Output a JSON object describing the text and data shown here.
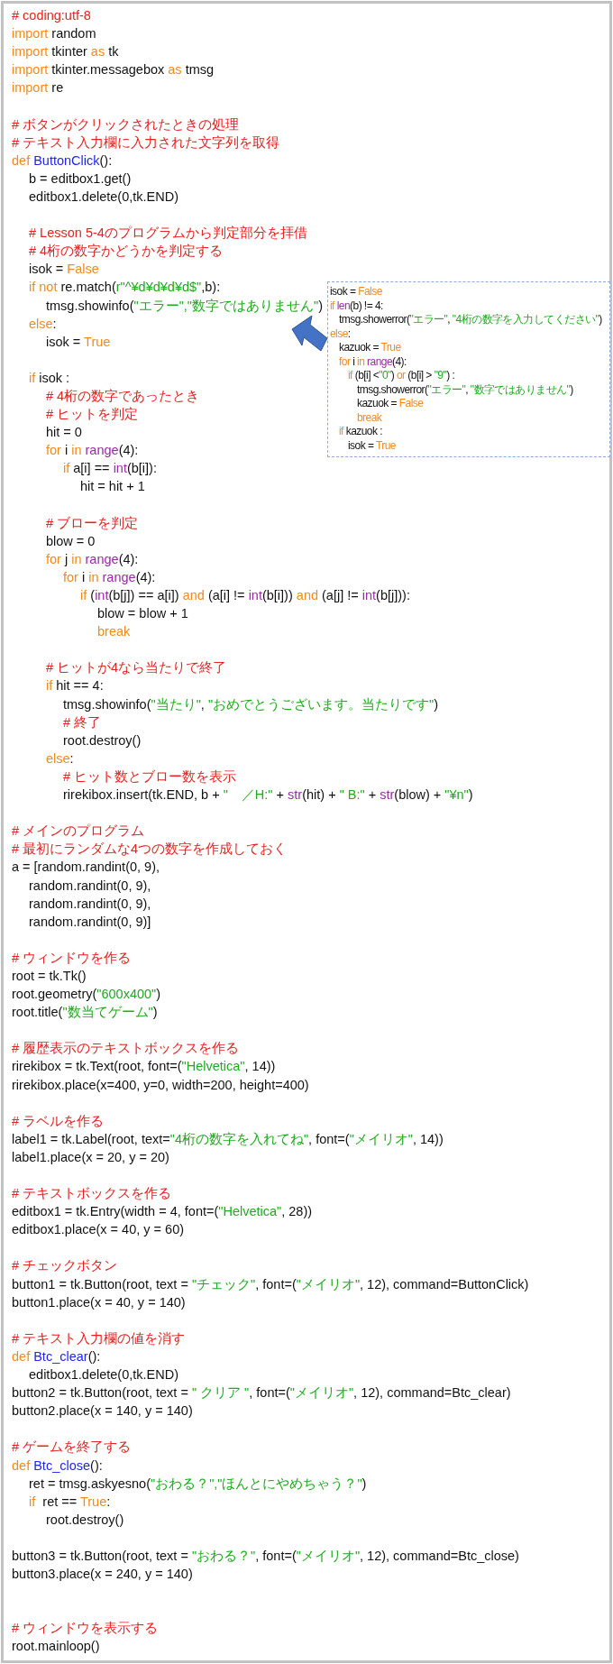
{
  "code_listing": {
    "lines": [
      {
        "kind": "code",
        "tokens": [
          {
            "kind": "comment",
            "text": "# coding:utf-8"
          }
        ]
      },
      {
        "kind": "code",
        "tokens": [
          {
            "kind": "keyword",
            "text": "import"
          },
          {
            "kind": "plain",
            "text": " random"
          }
        ]
      },
      {
        "kind": "code",
        "tokens": [
          {
            "kind": "keyword",
            "text": "import"
          },
          {
            "kind": "plain",
            "text": " tkinter "
          },
          {
            "kind": "keyword",
            "text": "as"
          },
          {
            "kind": "plain",
            "text": " tk"
          }
        ]
      },
      {
        "kind": "code",
        "tokens": [
          {
            "kind": "keyword",
            "text": "import"
          },
          {
            "kind": "plain",
            "text": " tkinter.messagebox "
          },
          {
            "kind": "keyword",
            "text": "as"
          },
          {
            "kind": "plain",
            "text": " tmsg"
          }
        ]
      },
      {
        "kind": "code",
        "tokens": [
          {
            "kind": "keyword",
            "text": "import"
          },
          {
            "kind": "plain",
            "text": " re"
          }
        ]
      },
      {
        "kind": "blank"
      },
      {
        "kind": "code",
        "tokens": [
          {
            "kind": "comment",
            "text": "# ボタンがクリックされたときの処理"
          }
        ]
      },
      {
        "kind": "code",
        "tokens": [
          {
            "kind": "comment",
            "text": "# テキスト入力欄に入力された文字列を取得"
          }
        ]
      },
      {
        "kind": "code",
        "tokens": [
          {
            "kind": "keyword",
            "text": "def "
          },
          {
            "kind": "function",
            "text": "ButtonClick"
          },
          {
            "kind": "plain",
            "text": "():"
          }
        ],
        "children": [
          {
            "kind": "code",
            "tokens": [
              {
                "kind": "plain",
                "text": "b = editbox1.get()"
              }
            ]
          },
          {
            "kind": "code",
            "tokens": [
              {
                "kind": "plain",
                "text": "editbox1.delete(0,tk.END)"
              }
            ]
          },
          {
            "kind": "blank"
          },
          {
            "kind": "code",
            "tokens": [
              {
                "kind": "comment",
                "text": "# Lesson 5-4のプログラムから判定部分を拝借"
              }
            ]
          },
          {
            "kind": "code",
            "tokens": [
              {
                "kind": "comment",
                "text": "# 4桁の数字かどうかを判定する"
              }
            ]
          },
          {
            "kind": "code",
            "tokens": [
              {
                "kind": "plain",
                "text": "isok = "
              },
              {
                "kind": "keyword",
                "text": "False"
              }
            ]
          },
          {
            "kind": "code",
            "tokens": [
              {
                "kind": "keyword",
                "text": "if not "
              },
              {
                "kind": "plain",
                "text": "re.match("
              },
              {
                "kind": "string",
                "text": "r\"^¥d¥d¥d¥d$\""
              },
              {
                "kind": "plain",
                "text": ",b):"
              }
            ],
            "children": [
              {
                "kind": "code",
                "tokens": [
                  {
                    "kind": "plain",
                    "text": "tmsg.showinfo("
                  },
                  {
                    "kind": "string",
                    "text": "\"エラー\",\"数字ではありません\""
                  },
                  {
                    "kind": "plain",
                    "text": ")"
                  }
                ]
              }
            ]
          },
          {
            "kind": "code",
            "tokens": [
              {
                "kind": "keyword",
                "text": "else"
              },
              {
                "kind": "plain",
                "text": ":"
              }
            ],
            "children": [
              {
                "kind": "code",
                "tokens": [
                  {
                    "kind": "plain",
                    "text": "isok = "
                  },
                  {
                    "kind": "keyword",
                    "text": "True"
                  }
                ]
              }
            ]
          },
          {
            "kind": "blank"
          },
          {
            "kind": "code",
            "tokens": [
              {
                "kind": "keyword",
                "text": "if "
              },
              {
                "kind": "plain",
                "text": "isok :"
              }
            ],
            "children": [
              {
                "kind": "code",
                "tokens": [
                  {
                    "kind": "comment",
                    "text": "# 4桁の数字であったとき"
                  }
                ]
              },
              {
                "kind": "code",
                "tokens": [
                  {
                    "kind": "comment",
                    "text": "# ヒットを判定"
                  }
                ]
              },
              {
                "kind": "code",
                "tokens": [
                  {
                    "kind": "plain",
                    "text": "hit = 0"
                  }
                ]
              },
              {
                "kind": "code",
                "tokens": [
                  {
                    "kind": "keyword",
                    "text": "for "
                  },
                  {
                    "kind": "plain",
                    "text": "i "
                  },
                  {
                    "kind": "keyword",
                    "text": "in "
                  },
                  {
                    "kind": "builtin",
                    "text": "range"
                  },
                  {
                    "kind": "plain",
                    "text": "(4):"
                  }
                ],
                "children": [
                  {
                    "kind": "code",
                    "tokens": [
                      {
                        "kind": "keyword",
                        "text": "if "
                      },
                      {
                        "kind": "plain",
                        "text": "a[i] == "
                      },
                      {
                        "kind": "builtin",
                        "text": "int"
                      },
                      {
                        "kind": "plain",
                        "text": "(b[i]):"
                      }
                    ],
                    "children": [
                      {
                        "kind": "code",
                        "tokens": [
                          {
                            "kind": "plain",
                            "text": "hit = hit + 1"
                          }
                        ]
                      }
                    ]
                  }
                ]
              },
              {
                "kind": "blank"
              },
              {
                "kind": "code",
                "tokens": [
                  {
                    "kind": "comment",
                    "text": "# ブローを判定"
                  }
                ]
              },
              {
                "kind": "code",
                "tokens": [
                  {
                    "kind": "plain",
                    "text": "blow = 0"
                  }
                ]
              },
              {
                "kind": "code",
                "tokens": [
                  {
                    "kind": "keyword",
                    "text": "for "
                  },
                  {
                    "kind": "plain",
                    "text": "j "
                  },
                  {
                    "kind": "keyword",
                    "text": "in "
                  },
                  {
                    "kind": "builtin",
                    "text": "range"
                  },
                  {
                    "kind": "plain",
                    "text": "(4):"
                  }
                ],
                "children": [
                  {
                    "kind": "code",
                    "tokens": [
                      {
                        "kind": "keyword",
                        "text": "for "
                      },
                      {
                        "kind": "plain",
                        "text": "i "
                      },
                      {
                        "kind": "keyword",
                        "text": "in "
                      },
                      {
                        "kind": "builtin",
                        "text": "range"
                      },
                      {
                        "kind": "plain",
                        "text": "(4):"
                      }
                    ],
                    "children": [
                      {
                        "kind": "code",
                        "tokens": [
                          {
                            "kind": "keyword",
                            "text": "if "
                          },
                          {
                            "kind": "plain",
                            "text": "("
                          },
                          {
                            "kind": "builtin",
                            "text": "int"
                          },
                          {
                            "kind": "plain",
                            "text": "(b[j]) == a[i]) "
                          },
                          {
                            "kind": "keyword",
                            "text": "and"
                          },
                          {
                            "kind": "plain",
                            "text": " (a[i] != "
                          },
                          {
                            "kind": "builtin",
                            "text": "int"
                          },
                          {
                            "kind": "plain",
                            "text": "(b[i])) "
                          },
                          {
                            "kind": "keyword",
                            "text": "and"
                          },
                          {
                            "kind": "plain",
                            "text": " (a[j] != "
                          },
                          {
                            "kind": "builtin",
                            "text": "int"
                          },
                          {
                            "kind": "plain",
                            "text": "(b[j])):"
                          }
                        ],
                        "children": [
                          {
                            "kind": "code",
                            "tokens": [
                              {
                                "kind": "plain",
                                "text": "blow = blow + 1"
                              }
                            ]
                          },
                          {
                            "kind": "code",
                            "tokens": [
                              {
                                "kind": "keyword",
                                "text": "break"
                              }
                            ]
                          }
                        ]
                      }
                    ]
                  }
                ]
              },
              {
                "kind": "blank"
              },
              {
                "kind": "code",
                "tokens": [
                  {
                    "kind": "comment",
                    "text": "# ヒットが4なら当たりで終了"
                  }
                ]
              },
              {
                "kind": "code",
                "tokens": [
                  {
                    "kind": "keyword",
                    "text": "if "
                  },
                  {
                    "kind": "plain",
                    "text": "hit == 4:"
                  }
                ],
                "children": [
                  {
                    "kind": "code",
                    "tokens": [
                      {
                        "kind": "plain",
                        "text": "tmsg.showinfo("
                      },
                      {
                        "kind": "string",
                        "text": "\"当たり\""
                      },
                      {
                        "kind": "plain",
                        "text": ", "
                      },
                      {
                        "kind": "string",
                        "text": "\"おめでとうございます。当たりです\""
                      },
                      {
                        "kind": "plain",
                        "text": ")"
                      }
                    ]
                  },
                  {
                    "kind": "code",
                    "tokens": [
                      {
                        "kind": "comment",
                        "text": "# 終了"
                      }
                    ]
                  },
                  {
                    "kind": "code",
                    "tokens": [
                      {
                        "kind": "plain",
                        "text": "root.destroy()"
                      }
                    ]
                  }
                ]
              },
              {
                "kind": "code",
                "tokens": [
                  {
                    "kind": "keyword",
                    "text": "else"
                  },
                  {
                    "kind": "plain",
                    "text": ":"
                  }
                ],
                "children": [
                  {
                    "kind": "code",
                    "tokens": [
                      {
                        "kind": "comment",
                        "text": "# ヒット数とブロー数を表示"
                      }
                    ]
                  },
                  {
                    "kind": "code",
                    "tokens": [
                      {
                        "kind": "plain",
                        "text": "rirekibox.insert(tk.END, b + "
                      },
                      {
                        "kind": "string",
                        "text": "\"　／H:\""
                      },
                      {
                        "kind": "plain",
                        "text": " + "
                      },
                      {
                        "kind": "builtin",
                        "text": "str"
                      },
                      {
                        "kind": "plain",
                        "text": "(hit) + "
                      },
                      {
                        "kind": "string",
                        "text": "\" B:\""
                      },
                      {
                        "kind": "plain",
                        "text": " + "
                      },
                      {
                        "kind": "builtin",
                        "text": "str"
                      },
                      {
                        "kind": "plain",
                        "text": "(blow) + "
                      },
                      {
                        "kind": "string",
                        "text": "\"¥n\""
                      },
                      {
                        "kind": "plain",
                        "text": ")"
                      }
                    ]
                  }
                ]
              }
            ]
          }
        ]
      },
      {
        "kind": "blank"
      },
      {
        "kind": "code",
        "tokens": [
          {
            "kind": "comment",
            "text": "# メインのプログラム"
          }
        ]
      },
      {
        "kind": "code",
        "tokens": [
          {
            "kind": "comment",
            "text": "# 最初にランダムな4つの数字を作成しておく"
          }
        ]
      },
      {
        "kind": "code",
        "tokens": [
          {
            "kind": "plain",
            "text": "a = [random.randint(0, 9),"
          }
        ],
        "children": [
          {
            "kind": "code",
            "tokens": [
              {
                "kind": "plain",
                "text": "random.randint(0, 9),"
              }
            ]
          },
          {
            "kind": "code",
            "tokens": [
              {
                "kind": "plain",
                "text": "random.randint(0, 9),"
              }
            ]
          },
          {
            "kind": "code",
            "tokens": [
              {
                "kind": "plain",
                "text": "random.randint(0, 9)]"
              }
            ]
          }
        ]
      },
      {
        "kind": "blank"
      },
      {
        "kind": "code",
        "tokens": [
          {
            "kind": "comment",
            "text": "# ウィンドウを作る"
          }
        ]
      },
      {
        "kind": "code",
        "tokens": [
          {
            "kind": "plain",
            "text": "root = tk.Tk()"
          }
        ]
      },
      {
        "kind": "code",
        "tokens": [
          {
            "kind": "plain",
            "text": "root.geometry("
          },
          {
            "kind": "string",
            "text": "\"600x400\""
          },
          {
            "kind": "plain",
            "text": ")"
          }
        ]
      },
      {
        "kind": "code",
        "tokens": [
          {
            "kind": "plain",
            "text": "root.title("
          },
          {
            "kind": "string",
            "text": "\"数当てゲーム\""
          },
          {
            "kind": "plain",
            "text": ")"
          }
        ]
      },
      {
        "kind": "blank"
      },
      {
        "kind": "code",
        "tokens": [
          {
            "kind": "comment",
            "text": "# 履歴表示のテキストボックスを作る"
          }
        ]
      },
      {
        "kind": "code",
        "tokens": [
          {
            "kind": "plain",
            "text": "rirekibox = tk.Text(root, font=("
          },
          {
            "kind": "string",
            "text": "\"Helvetica\""
          },
          {
            "kind": "plain",
            "text": ", 14))"
          }
        ]
      },
      {
        "kind": "code",
        "tokens": [
          {
            "kind": "plain",
            "text": "rirekibox.place(x=400, y=0, width=200, height=400)"
          }
        ]
      },
      {
        "kind": "blank"
      },
      {
        "kind": "code",
        "tokens": [
          {
            "kind": "comment",
            "text": "# ラベルを作る"
          }
        ]
      },
      {
        "kind": "code",
        "tokens": [
          {
            "kind": "plain",
            "text": "label1 = tk.Label(root, text="
          },
          {
            "kind": "string",
            "text": "\"4桁の数字を入れてね\""
          },
          {
            "kind": "plain",
            "text": ", font=("
          },
          {
            "kind": "string",
            "text": "\"メイリオ\""
          },
          {
            "kind": "plain",
            "text": ", 14))"
          }
        ]
      },
      {
        "kind": "code",
        "tokens": [
          {
            "kind": "plain",
            "text": "label1.place(x = 20, y = 20)"
          }
        ]
      },
      {
        "kind": "blank"
      },
      {
        "kind": "code",
        "tokens": [
          {
            "kind": "comment",
            "text": "# テキストボックスを作る"
          }
        ]
      },
      {
        "kind": "code",
        "tokens": [
          {
            "kind": "plain",
            "text": "editbox1 = tk.Entry(width = 4, font=("
          },
          {
            "kind": "string",
            "text": "\"Helvetica\""
          },
          {
            "kind": "plain",
            "text": ", 28))"
          }
        ]
      },
      {
        "kind": "code",
        "tokens": [
          {
            "kind": "plain",
            "text": "editbox1.place(x = 40, y = 60)"
          }
        ]
      },
      {
        "kind": "blank"
      },
      {
        "kind": "code",
        "tokens": [
          {
            "kind": "comment",
            "text": "# チェックボタン"
          }
        ]
      },
      {
        "kind": "code",
        "tokens": [
          {
            "kind": "plain",
            "text": "button1 = tk.Button(root, text = "
          },
          {
            "kind": "string",
            "text": "\"チェック\""
          },
          {
            "kind": "plain",
            "text": ", font=("
          },
          {
            "kind": "string",
            "text": "\"メイリオ\""
          },
          {
            "kind": "plain",
            "text": ", 12), command=ButtonClick)"
          }
        ]
      },
      {
        "kind": "code",
        "tokens": [
          {
            "kind": "plain",
            "text": "button1.place(x = 40, y = 140)"
          }
        ]
      },
      {
        "kind": "blank"
      },
      {
        "kind": "code",
        "tokens": [
          {
            "kind": "comment",
            "text": "# テキスト入力欄の値を消す"
          }
        ]
      },
      {
        "kind": "code",
        "tokens": [
          {
            "kind": "keyword",
            "text": "def "
          },
          {
            "kind": "function",
            "text": "Btc_clear"
          },
          {
            "kind": "plain",
            "text": "():"
          }
        ],
        "children": [
          {
            "kind": "code",
            "tokens": [
              {
                "kind": "plain",
                "text": "editbox1.delete(0,tk.END)"
              }
            ]
          }
        ]
      },
      {
        "kind": "code",
        "tokens": [
          {
            "kind": "plain",
            "text": "button2 = tk.Button(root, text = "
          },
          {
            "kind": "string",
            "text": "\" クリア \""
          },
          {
            "kind": "plain",
            "text": ", font=("
          },
          {
            "kind": "string",
            "text": "\"メイリオ\""
          },
          {
            "kind": "plain",
            "text": ", 12), command=Btc_clear)"
          }
        ]
      },
      {
        "kind": "code",
        "tokens": [
          {
            "kind": "plain",
            "text": "button2.place(x = 140, y = 140)"
          }
        ]
      },
      {
        "kind": "blank"
      },
      {
        "kind": "code",
        "tokens": [
          {
            "kind": "comment",
            "text": "# ゲームを終了する"
          }
        ]
      },
      {
        "kind": "code",
        "tokens": [
          {
            "kind": "keyword",
            "text": "def "
          },
          {
            "kind": "function",
            "text": "Btc_close"
          },
          {
            "kind": "plain",
            "text": "():"
          }
        ],
        "children": [
          {
            "kind": "code",
            "tokens": [
              {
                "kind": "plain",
                "text": "ret = tmsg.askyesno("
              },
              {
                "kind": "string",
                "text": "\"おわる？\",\"ほんとにやめちゃう？\""
              },
              {
                "kind": "plain",
                "text": ")"
              }
            ]
          },
          {
            "kind": "code",
            "tokens": [
              {
                "kind": "keyword",
                "text": "if"
              },
              {
                "kind": "plain",
                "text": "  ret == "
              },
              {
                "kind": "keyword",
                "text": "True"
              },
              {
                "kind": "plain",
                "text": ":"
              }
            ],
            "children": [
              {
                "kind": "code",
                "tokens": [
                  {
                    "kind": "plain",
                    "text": "root.destroy()"
                  }
                ]
              }
            ]
          }
        ]
      },
      {
        "kind": "blank"
      },
      {
        "kind": "code",
        "tokens": [
          {
            "kind": "plain",
            "text": "button3 = tk.Button(root, text = "
          },
          {
            "kind": "string",
            "text": "\"おわる？\""
          },
          {
            "kind": "plain",
            "text": ", font=("
          },
          {
            "kind": "string",
            "text": "\"メイリオ\""
          },
          {
            "kind": "plain",
            "text": ", 12), command=Btc_close)"
          }
        ]
      },
      {
        "kind": "code",
        "tokens": [
          {
            "kind": "plain",
            "text": "button3.place(x = 240, y = 140)"
          }
        ]
      },
      {
        "kind": "blank"
      },
      {
        "kind": "blank"
      },
      {
        "kind": "code",
        "tokens": [
          {
            "kind": "comment",
            "text": "# ウィンドウを表示する"
          }
        ]
      },
      {
        "kind": "code",
        "tokens": [
          {
            "kind": "plain",
            "text": "root.mainloop()"
          }
        ]
      }
    ]
  },
  "callout": {
    "lines": [
      {
        "kind": "code",
        "tokens": [
          {
            "kind": "plain",
            "text": "isok = "
          },
          {
            "kind": "keyword",
            "text": "False"
          }
        ]
      },
      {
        "kind": "code",
        "tokens": [
          {
            "kind": "keyword",
            "text": "if "
          },
          {
            "kind": "builtin",
            "text": "len"
          },
          {
            "kind": "plain",
            "text": "(b) != 4:"
          }
        ],
        "children": [
          {
            "kind": "code",
            "tokens": [
              {
                "kind": "plain",
                "text": "tmsg.showerror("
              },
              {
                "kind": "string",
                "text": "\"エラー\""
              },
              {
                "kind": "plain",
                "text": ", "
              },
              {
                "kind": "string",
                "text": "\"4桁の数字を入力してください\""
              },
              {
                "kind": "plain",
                "text": ")"
              }
            ]
          }
        ]
      },
      {
        "kind": "code",
        "tokens": [
          {
            "kind": "keyword",
            "text": "else"
          },
          {
            "kind": "plain",
            "text": ":"
          }
        ],
        "children": [
          {
            "kind": "code",
            "tokens": [
              {
                "kind": "plain",
                "text": "kazuok = "
              },
              {
                "kind": "keyword",
                "text": "True"
              }
            ]
          },
          {
            "kind": "code",
            "tokens": [
              {
                "kind": "keyword",
                "text": "for "
              },
              {
                "kind": "plain",
                "text": "i "
              },
              {
                "kind": "keyword",
                "text": "in "
              },
              {
                "kind": "builtin",
                "text": "range"
              },
              {
                "kind": "plain",
                "text": "(4):"
              }
            ],
            "children": [
              {
                "kind": "code",
                "tokens": [
                  {
                    "kind": "keyword",
                    "text": "if "
                  },
                  {
                    "kind": "plain",
                    "text": "(b[i] <"
                  },
                  {
                    "kind": "string",
                    "text": "\"0\""
                  },
                  {
                    "kind": "plain",
                    "text": ") "
                  },
                  {
                    "kind": "keyword",
                    "text": "or"
                  },
                  {
                    "kind": "plain",
                    "text": " (b[i] > "
                  },
                  {
                    "kind": "string",
                    "text": "\"9\""
                  },
                  {
                    "kind": "plain",
                    "text": ") :"
                  }
                ],
                "children": [
                  {
                    "kind": "code",
                    "tokens": [
                      {
                        "kind": "plain",
                        "text": "tmsg.showerror("
                      },
                      {
                        "kind": "string",
                        "text": "\"エラー\""
                      },
                      {
                        "kind": "plain",
                        "text": ", "
                      },
                      {
                        "kind": "string",
                        "text": "\"数字ではありません\""
                      },
                      {
                        "kind": "plain",
                        "text": ")"
                      }
                    ]
                  },
                  {
                    "kind": "code",
                    "tokens": [
                      {
                        "kind": "plain",
                        "text": "kazuok = "
                      },
                      {
                        "kind": "keyword",
                        "text": "False"
                      }
                    ]
                  },
                  {
                    "kind": "code",
                    "tokens": [
                      {
                        "kind": "keyword",
                        "text": "break"
                      }
                    ]
                  }
                ]
              }
            ]
          },
          {
            "kind": "code",
            "tokens": [
              {
                "kind": "keyword",
                "text": "if "
              },
              {
                "kind": "plain",
                "text": "kazuok :"
              }
            ],
            "children": [
              {
                "kind": "code",
                "tokens": [
                  {
                    "kind": "plain",
                    "text": "isok = "
                  },
                  {
                    "kind": "keyword",
                    "text": "True"
                  }
                ]
              }
            ]
          }
        ]
      }
    ]
  }
}
